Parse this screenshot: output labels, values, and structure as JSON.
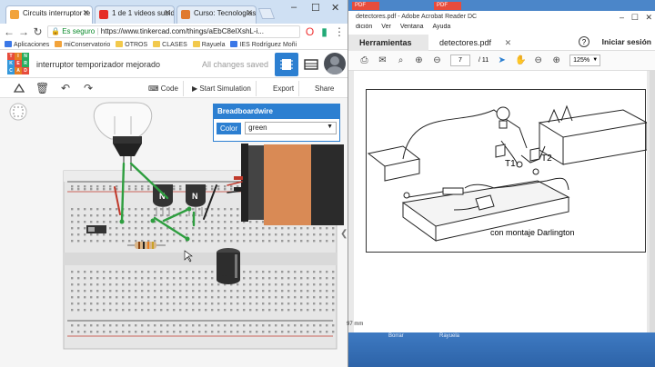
{
  "browser": {
    "tabs": [
      {
        "label": "Circuits interruptor te",
        "color": "#f2a33a"
      },
      {
        "label": "1 de 1 videos subido",
        "color": "#e52d27"
      },
      {
        "label": "Curso: Tecnologías 4",
        "color": "#e07a2f"
      }
    ],
    "url_secure_label": "Es seguro",
    "url": "https://www.tinkercad.com/things/aEbC8eIXshL-i...",
    "bookmarks": [
      {
        "label": "Aplicaciones",
        "color": "#3b78e7"
      },
      {
        "label": "miConservatorio",
        "color": "#f2a33a"
      },
      {
        "label": "OTROS",
        "color": "#f2c94c"
      },
      {
        "label": "CLASES",
        "color": "#f2c94c"
      },
      {
        "label": "Rayuela",
        "color": "#f2c94c"
      },
      {
        "label": "IES Rodríguez Moñi",
        "color": "#3b78e7"
      }
    ]
  },
  "tinkercad": {
    "logo_letters": [
      "T",
      "I",
      "N",
      "K",
      "E",
      "R",
      "C",
      "A",
      "D"
    ],
    "project_title": "interruptor temporizador mejorado",
    "save_status": "All changes saved",
    "toolbar": {
      "code_label": "Code",
      "simulation_label": "Start Simulation",
      "export_label": "Export",
      "share_label": "Share"
    },
    "inspector": {
      "title": "Breadboardwire",
      "color_label": "Color",
      "color_value": "green"
    }
  },
  "desktop_tabs": [
    {
      "label": "PDF"
    },
    {
      "label": "PDF"
    }
  ],
  "acrobat": {
    "window_title": "detectores.pdf - Adobe Acrobat Reader DC",
    "menu": [
      "dición",
      "Ver",
      "Ventana",
      "Ayuda"
    ],
    "tools_tab": "Herramientas",
    "doc_tab": "detectores.pdf",
    "help_glyph": "?",
    "login": "Iniciar sesión",
    "page_current": "7",
    "page_total": "/ 11",
    "zoom": "125%",
    "figure_labels": {
      "t1": "T1",
      "t2": "T2"
    },
    "caption": "con montaje Darlington"
  },
  "status": {
    "mm": "97 mm"
  },
  "desktop_labels": [
    "Borrar",
    "Rayuela"
  ]
}
